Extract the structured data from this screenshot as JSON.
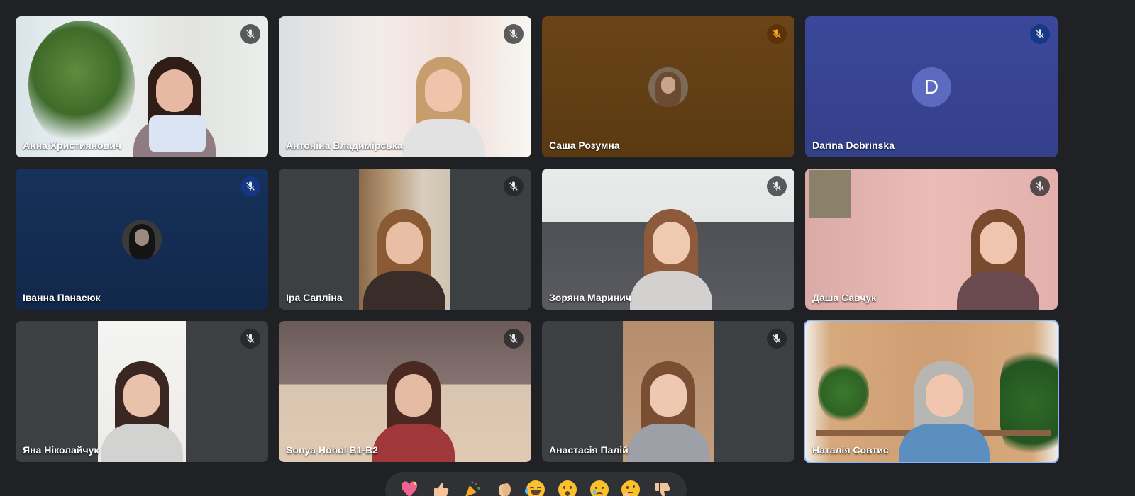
{
  "participants": [
    {
      "name": "Анна Християнович",
      "muted": true
    },
    {
      "name": "Антоніна Владимірська",
      "muted": true
    },
    {
      "name": "Саша Розумна",
      "muted": true
    },
    {
      "name": "Darina Dobrinska",
      "muted": true,
      "avatar_letter": "D"
    },
    {
      "name": "Іванна Панасюк",
      "muted": true
    },
    {
      "name": "Іра Сапліна",
      "muted": true
    },
    {
      "name": "Зоряна Маринич",
      "muted": true
    },
    {
      "name": "Даша Савчук",
      "muted": true
    },
    {
      "name": "Яна Ніколайчук",
      "muted": true
    },
    {
      "name": "Sonya Hohol B1-B2",
      "muted": true
    },
    {
      "name": "Анастасія Палій",
      "muted": true
    },
    {
      "name": "Наталія Совтис",
      "muted": false,
      "speaking": true
    }
  ],
  "reactions": [
    {
      "icon": "sparkling-heart-icon"
    },
    {
      "icon": "thumbs-up-icon"
    },
    {
      "icon": "party-popper-icon"
    },
    {
      "icon": "clapping-hands-icon"
    },
    {
      "icon": "tears-of-joy-icon"
    },
    {
      "icon": "surprised-face-icon"
    },
    {
      "icon": "crying-face-icon"
    },
    {
      "icon": "thinking-face-icon"
    },
    {
      "icon": "thumbs-down-icon"
    }
  ],
  "colors": {
    "background": "#202124",
    "speaking_outline": "#8ab4f8",
    "letter_avatar": "#5c6bc0"
  }
}
